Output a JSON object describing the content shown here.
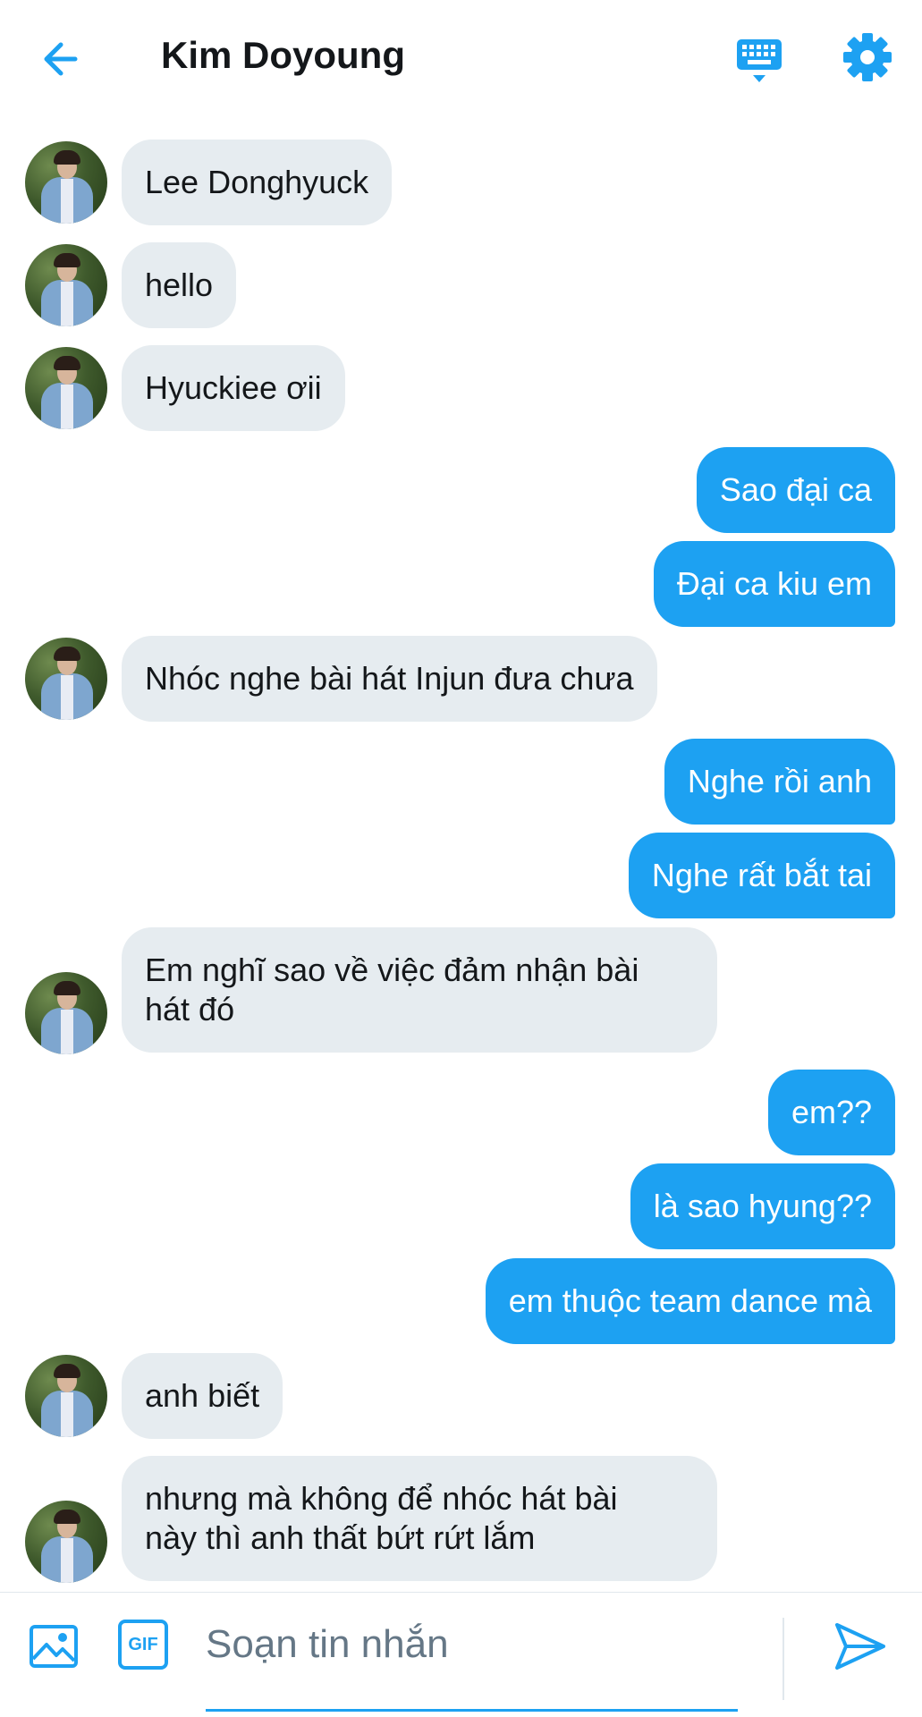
{
  "header": {
    "title": "Kim Doyoung"
  },
  "icons": {
    "back": "arrow-left-icon",
    "keyboard": "keyboard-icon",
    "settings": "gear-icon",
    "image": "image-icon",
    "gif": "gif-icon",
    "send": "send-icon"
  },
  "colors": {
    "accent": "#1da1f2",
    "incoming_bubble": "#e6ecf0",
    "text": "#14171a",
    "placeholder": "#657786"
  },
  "messages": [
    {
      "direction": "in",
      "text": "Lee Donghyuck"
    },
    {
      "direction": "in",
      "text": "hello"
    },
    {
      "direction": "in",
      "text": "Hyuckiee ơii"
    },
    {
      "direction": "out",
      "text": "Sao đại ca"
    },
    {
      "direction": "out",
      "text": "Đại ca kiu em"
    },
    {
      "direction": "in",
      "text": "Nhóc nghe bài hát Injun đưa chưa"
    },
    {
      "direction": "out",
      "text": "Nghe rồi anh"
    },
    {
      "direction": "out",
      "text": "Nghe rất bắt tai"
    },
    {
      "direction": "in",
      "text": "Em nghĩ sao về việc đảm nhận bài\nhát đó"
    },
    {
      "direction": "out",
      "text": "em??"
    },
    {
      "direction": "out",
      "text": "là sao hyung??"
    },
    {
      "direction": "out",
      "text": "em thuộc team dance mà"
    },
    {
      "direction": "in",
      "text": "anh biết"
    },
    {
      "direction": "in",
      "text": "nhưng mà không để nhóc hát bài\nnày thì anh thất bứt rứt lắm"
    }
  ],
  "composer": {
    "gif_label": "GIF",
    "placeholder": "Soạn tin nhắn",
    "value": ""
  }
}
